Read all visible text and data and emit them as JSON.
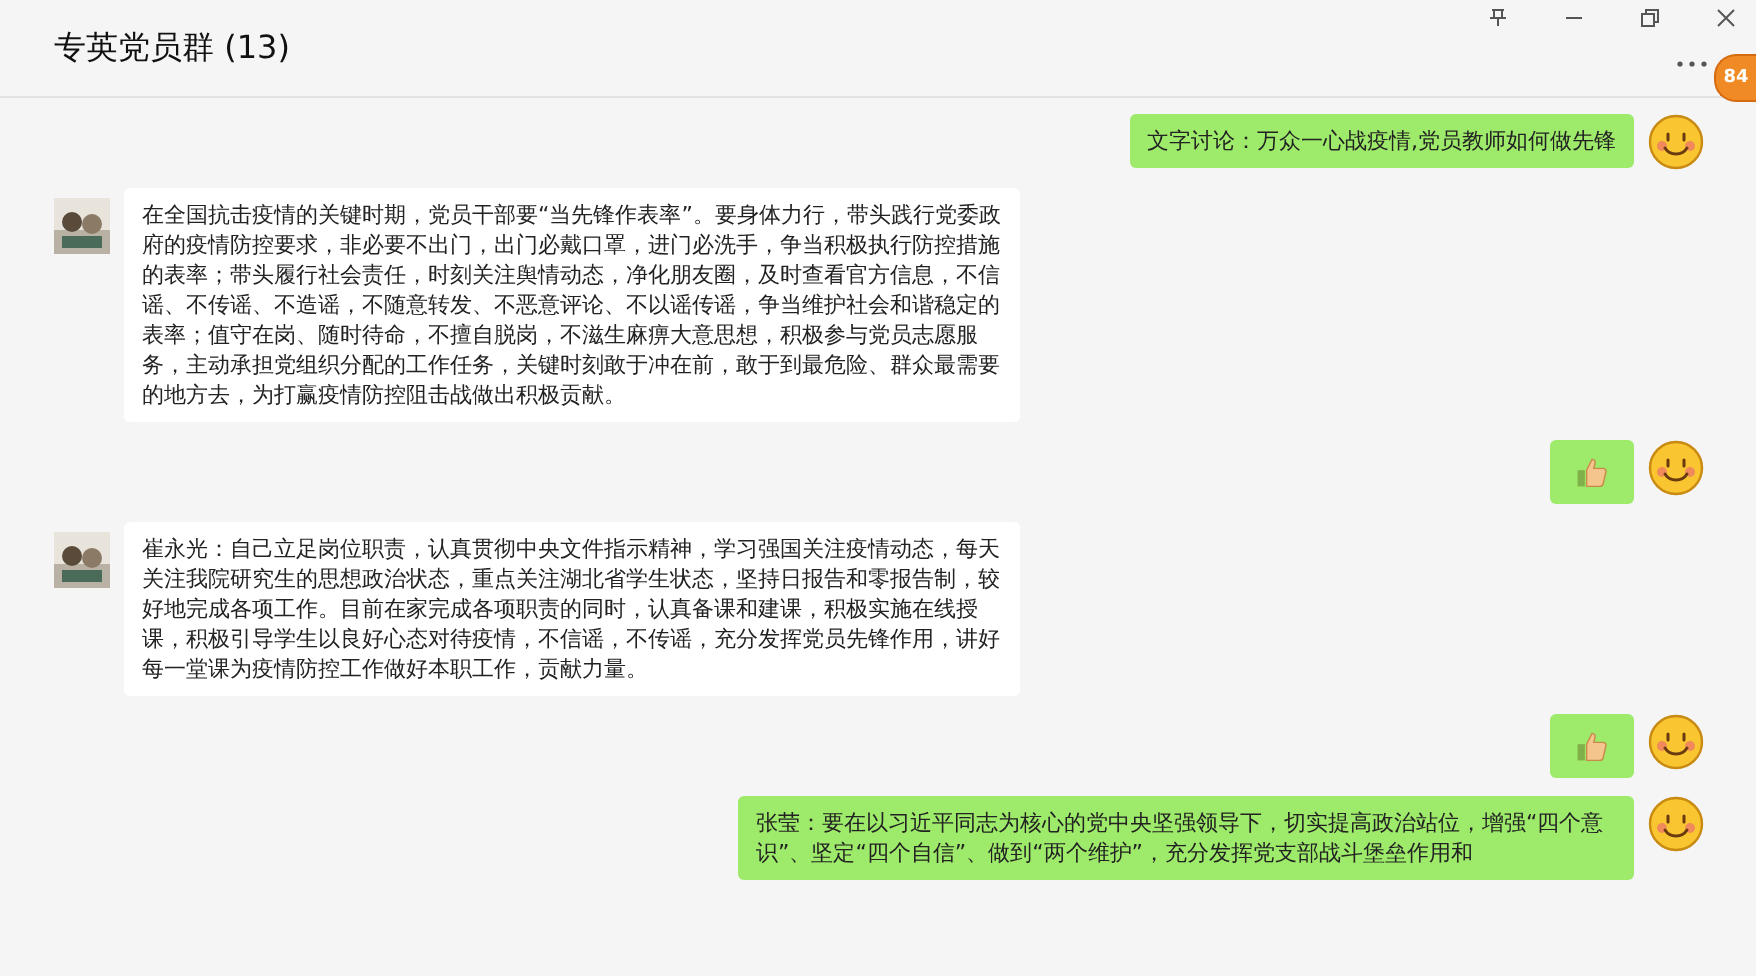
{
  "window": {
    "title": "专英党员群 (13)"
  },
  "badge": "84",
  "messages": [
    {
      "outgoing": true,
      "kind": "text",
      "text": "文字讨论：万众一心战疫情,党员教师如何做先锋"
    },
    {
      "outgoing": false,
      "kind": "text",
      "text": "在全国抗击疫情的关键时期，党员干部要“当先锋作表率”。要身体力行，带头践行党委政府的疫情防控要求，非必要不出门，出门必戴口罩，进门必洗手，争当积极执行防控措施的表率；带头履行社会责任，时刻关注舆情动态，净化朋友圈，及时查看官方信息，不信谣、不传谣、不造谣，不随意转发、不恶意评论、不以谣传谣，争当维护社会和谐稳定的表率；值守在岗、随时待命，不擅自脱岗，不滋生麻痹大意思想，积极参与党员志愿服务，主动承担党组织分配的工作任务，关键时刻敢于冲在前，敢于到最危险、群众最需要的地方去，为打赢疫情防控阻击战做出积极贡献。"
    },
    {
      "outgoing": true,
      "kind": "thumbs"
    },
    {
      "outgoing": false,
      "kind": "text",
      "text": "崔永光：自己立足岗位职责，认真贯彻中央文件指示精神，学习强国关注疫情动态，每天关注我院研究生的思想政治状态，重点关注湖北省学生状态，坚持日报告和零报告制，较好地完成各项工作。目前在家完成各项职责的同时，认真备课和建课，积极实施在线授课，积极引导学生以良好心态对待疫情，不信谣，不传谣，充分发挥党员先锋作用，讲好每一堂课为疫情防控工作做好本职工作，贡献力量。"
    },
    {
      "outgoing": true,
      "kind": "thumbs"
    },
    {
      "outgoing": true,
      "kind": "text",
      "text": "张莹：要在以习近平同志为核心的党中央坚强领导下，切实提高政治站位，增强“四个意识”、坚定“四个自信”、做到“两个维护”，充分发挥党支部战斗堡垒作用和"
    }
  ]
}
